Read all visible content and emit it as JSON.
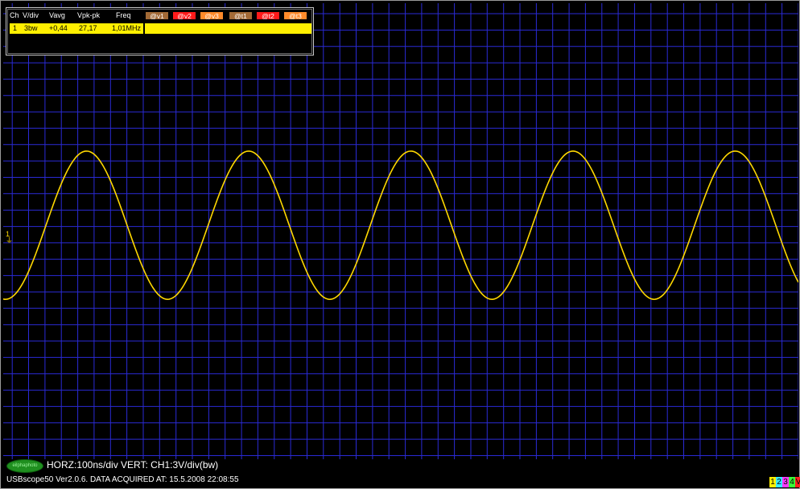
{
  "measurements": {
    "headers": {
      "ch": "Ch",
      "vdiv": "V/div",
      "vavg": "Vavg",
      "vpkpk": "Vpk-pk",
      "freq": "Freq"
    },
    "cursor_tags": [
      {
        "label": "@v1",
        "color": "#a36a36"
      },
      {
        "label": "@v2",
        "color": "#ff1a1a"
      },
      {
        "label": "@v3",
        "color": "#ff8a2a"
      },
      {
        "label": "@t1",
        "color": "#a36a36"
      },
      {
        "label": "@t2",
        "color": "#ff1a1a"
      },
      {
        "label": "@t3",
        "color": "#ff8a2a"
      }
    ],
    "rows": [
      {
        "ch": "1",
        "vdiv": "3bw",
        "vavg": "+0,44",
        "vpkpk": "27,17",
        "freq": "1,01MHz"
      }
    ]
  },
  "waveform": {
    "color": "#ffd800",
    "frequency_mhz": 1.01,
    "vpp": 27.17,
    "vavg": 0.44,
    "horz_ns_per_div": 100,
    "vert_v_per_div": 3
  },
  "grid_color": "#2a2ad6",
  "ground_marker": "1",
  "logo_text": "eilphaphoto",
  "status_line": "HORZ:100ns/div VERT: CH1:3V/div(bw)",
  "footer_line": "USBscope50 Ver2.0.6.  DATA ACQUIRED AT: 15.5.2008 22:08:55",
  "channel_selector": [
    {
      "label": "1",
      "color": "#ffef00"
    },
    {
      "label": "2",
      "color": "#38e8ff"
    },
    {
      "label": "3",
      "color": "#ff38ff"
    },
    {
      "label": "4",
      "color": "#38ff38"
    },
    {
      "label": "V",
      "color": "#ff2020"
    }
  ]
}
